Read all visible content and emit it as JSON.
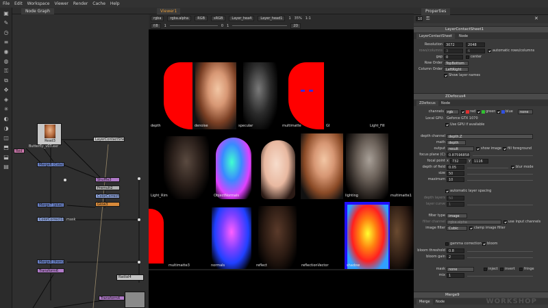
{
  "menu": [
    "File",
    "Edit",
    "Workspace",
    "Viewer",
    "Render",
    "Cache",
    "Help"
  ],
  "node_graph": {
    "tab": "Node Graph",
    "nodes": {
      "read3": "Read3",
      "read3_file": "Butterfly_v03.exr",
      "contact_sheet": "LayerContactSheet1",
      "red": "Red",
      "merge_cola": "Merge6 (Cola)",
      "shuffle": "Shuffle3",
      "premult": "Premult2",
      "colorcorrect_a": "ColorCorrect9",
      "glow": "Glow3",
      "merge_plus": "Merge7 (plus)",
      "colorcorrect_b": "ColorCorrect10",
      "mask": "mask",
      "merge_from": "Merge8 (from)",
      "transform6": "Transform6",
      "radial": "Radial4",
      "transform4": "Transform4"
    }
  },
  "viewer": {
    "tab": "Viewer1",
    "controls": {
      "channels": "rgba",
      "alpha": "rgba.alpha",
      "colorspace": "RGB",
      "lut": "sRGB",
      "layer_a": "Layer_hea4",
      "layer_b": "Layer_head1",
      "frame": "f/8",
      "exposure": "1",
      "zoom": "2D",
      "fstop": "1",
      "gain": "0",
      "gamma": "1",
      "zoom_ratio": "35%",
      "proxy": "1:1"
    },
    "cells": [
      "depth",
      "denoise",
      "specular",
      "multimatte",
      "GI",
      "Light_Fill",
      "Light_Rim",
      "ObjectNormals",
      "",
      "",
      "lighting",
      "multimatte1",
      "",
      "multimatte3",
      "normals",
      "reflect",
      "reflectionVector",
      "shadow",
      ""
    ]
  },
  "properties": {
    "tab": "Properties",
    "max_panels": "10",
    "contact_sheet": {
      "title": "LayerContactSheet1",
      "tabs": [
        "LayerContactSheet",
        "Node"
      ],
      "resolution_label": "Resolution",
      "resolution_w": "3072",
      "resolution_h": "2048",
      "rows_label": "rows/columns",
      "rows": "3",
      "cols": "6",
      "auto_rows": "automatic rows/columns",
      "gap_label": "gap",
      "gap": "0",
      "center": "center",
      "row_order_label": "Row Order",
      "row_order": "TopBottom",
      "col_order_label": "Column Order",
      "col_order": "LeftRight",
      "show_layer_names": "Show layer names"
    },
    "zdefocus": {
      "title": "ZDefocus4",
      "tabs": [
        "ZDefocus",
        "Node"
      ],
      "channels_label": "channels",
      "channels": "rgb",
      "red": "red",
      "green": "green",
      "blue": "blue",
      "extra": "none",
      "gpu_label": "Local GPU:",
      "gpu": "Geforce GTX 1070",
      "use_gpu": "Use GPU if available",
      "depth_channel_label": "depth channel",
      "depth_channel": "depth.Z",
      "math_label": "math",
      "math": "depth",
      "output_label": "output",
      "output": "result",
      "show_image": "show image",
      "fill_fg": "fill foreground",
      "focus_plane_label": "focus plane (C)",
      "focus_plane": "0.87596858",
      "focal_point_label": "focal point",
      "focal_x": "732",
      "focal_y": "1116",
      "dof_label": "depth of field",
      "dof": "0.05",
      "blur_mode": "blur mode",
      "size_label": "size",
      "size": "50",
      "maximum_label": "maximum",
      "maximum": "10",
      "auto_layer_spacing": "automatic layer spacing",
      "depth_layers_label": "depth layers",
      "depth_layers": "50",
      "layer_curve_label": "layer curve",
      "layer_curve": "1",
      "filter_type_label": "filter type",
      "filter_type": "image",
      "filter_channel_label": "filter channel",
      "filter_channel": "rgba.alpha",
      "use_input_channels": "use input channels",
      "image_filter_label": "image filter",
      "image_filter": "Cubic",
      "clamp_image_filter": "clamp image filter",
      "gamma_correction": "gamma correction",
      "bloom": "bloom",
      "bloom_threshold_label": "bloom threshold",
      "bloom_threshold": "0.8",
      "bloom_gain_label": "bloom gain",
      "bloom_gain": "2",
      "mask_label": "mask",
      "mask": "none",
      "inject": "inject",
      "invert": "invert",
      "fringe": "fringe",
      "mix_label": "mix",
      "mix": "1"
    },
    "merge9": {
      "title": "Merge9",
      "tabs": [
        "Merge",
        "Node"
      ]
    }
  },
  "watermark": "WORKSHOP",
  "colors": {
    "accent_orange": "#e39b3c",
    "node_blue": "#6a82c8",
    "node_purple": "#b07ac8",
    "node_pink": "#d07ab0",
    "node_grey": "#b0b0b0",
    "node_orange": "#d88a3a"
  }
}
